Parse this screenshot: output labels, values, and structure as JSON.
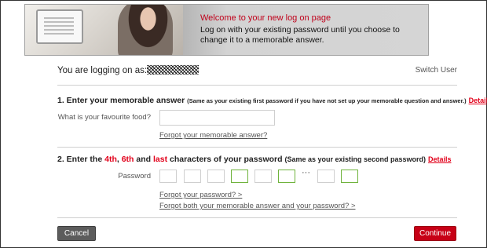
{
  "banner": {
    "title": "Welcome to your new log on page",
    "subtitle": "Log on with your existing password until you choose to change it to a memorable answer."
  },
  "logon": {
    "prefix": "You are logging on as:",
    "switch_user": "Switch User"
  },
  "section1": {
    "heading": "1. Enter your memorable answer",
    "note": "(Same as your existing first password if you have not set up your memorable question and answer.)",
    "details": "Details",
    "question_label": "What is your favourite food?",
    "answer_value": "",
    "forgot_link": "Forgot your memorable answer?"
  },
  "section2": {
    "heading_prefix": "2. Enter the",
    "char1": "4th",
    "sep1": ",",
    "char2": "6th",
    "sep2": "and",
    "char3": "last",
    "heading_suffix": "characters of your password",
    "note": "(Same as your existing second password)",
    "details": "Details",
    "password_label": "Password",
    "ellipsis": "···",
    "char_boxes": [
      {
        "active": false
      },
      {
        "active": false
      },
      {
        "active": false
      },
      {
        "active": true
      },
      {
        "active": false
      },
      {
        "active": true
      },
      {
        "active": false
      },
      {
        "active": true
      }
    ],
    "forgot_password": "Forgot your password? >",
    "forgot_both": "Forgot both your memorable answer and your password? >"
  },
  "actions": {
    "cancel": "Cancel",
    "continue": "Continue"
  },
  "colors": {
    "accent_red": "#e2001a",
    "active_box": "#6fb33c",
    "cancel_bg": "#5c5c5c",
    "continue_bg": "#c70016"
  }
}
